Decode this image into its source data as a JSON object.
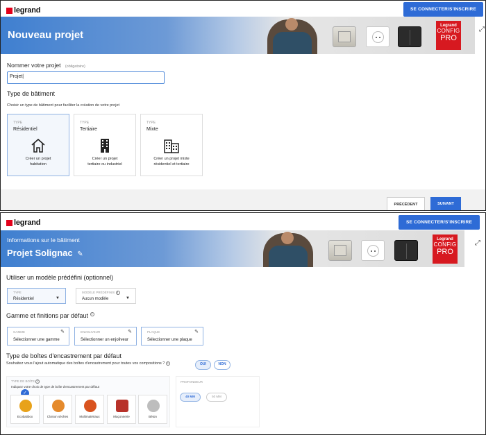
{
  "brand": {
    "name": "legrand"
  },
  "login_button": "SE CONNECTER/S'INSCRIRE",
  "expand_icon": "⤢",
  "screen1": {
    "banner_title": "Nouveau projet",
    "brand_box": {
      "line1": "Legrand",
      "line2": "CONFIG",
      "line3": "PRO"
    },
    "project_name_label": "Nommer votre projet",
    "project_name_required": "(obligatoire)",
    "project_name_value": "Projet",
    "building_type_heading": "Type de bâtiment",
    "building_type_help": "Choisir un type de bâtiment pour faciliter la création de votre projet",
    "type_cards": [
      {
        "tag": "TYPE",
        "name": "Résidentiel",
        "desc1": "Créer un projet",
        "desc2": "habitation",
        "icon": "house-icon"
      },
      {
        "tag": "TYPE",
        "name": "Tertiaire",
        "desc1": "Créer un projet",
        "desc2": "tertiaire ou industriel",
        "icon": "office-building-icon"
      },
      {
        "tag": "TYPE",
        "name": "Mixte",
        "desc1": "Créer un projet mixte",
        "desc2": "résidentiel et tertiaire",
        "icon": "mixed-building-icon"
      }
    ],
    "prev_button": "PRÉCÉDENT",
    "next_button": "SUIVANT"
  },
  "screen2": {
    "banner_subtitle": "Informations sur le bâtiment",
    "banner_title": "Projet Solignac",
    "model_heading": "Utiliser un modèle prédéfini (optionnel)",
    "type_select": {
      "label": "TYPE",
      "value": "Résidentiel"
    },
    "model_select": {
      "label": "MODÈLE PRÉDÉFINIS",
      "value": "Aucun modèle"
    },
    "gamme_heading": "Gamme et finitions par défaut",
    "gamme": {
      "label": "GAMME",
      "value": "Sélectionner une gamme"
    },
    "enjoliveur": {
      "label": "ENJOLIVEUR",
      "value": "Sélectionner un enjoliveur"
    },
    "plaque": {
      "label": "PLAQUE",
      "value": "Sélectionner une plaque"
    },
    "boxes_heading": "Type de boîtes d'encastrement par défaut",
    "boxes_question": "Souhaitez vous l'ajout automatique des boîtes d'encastrement pour toutes vos compositions ?",
    "yes_label": "OUI",
    "no_label": "NON",
    "box_type_label": "TYPE DE BOÎTE",
    "box_type_help": "Indiquez votre choix de type de boîte d'encastrement par défaut",
    "box_types": [
      {
        "name": "Ecobatibox",
        "color": "#e8a21a"
      },
      {
        "name": "Cloison sèches",
        "color": "#e58a2c"
      },
      {
        "name": "Multimatériaux",
        "color": "#d9531e"
      },
      {
        "name": "Maçonnerie",
        "color": "#b8322a"
      },
      {
        "name": "Béton",
        "color": "#bdbdbd"
      }
    ],
    "depth_label": "PROFONDEUR",
    "depth_40": "40 MM",
    "depth_50": "50 MM"
  }
}
